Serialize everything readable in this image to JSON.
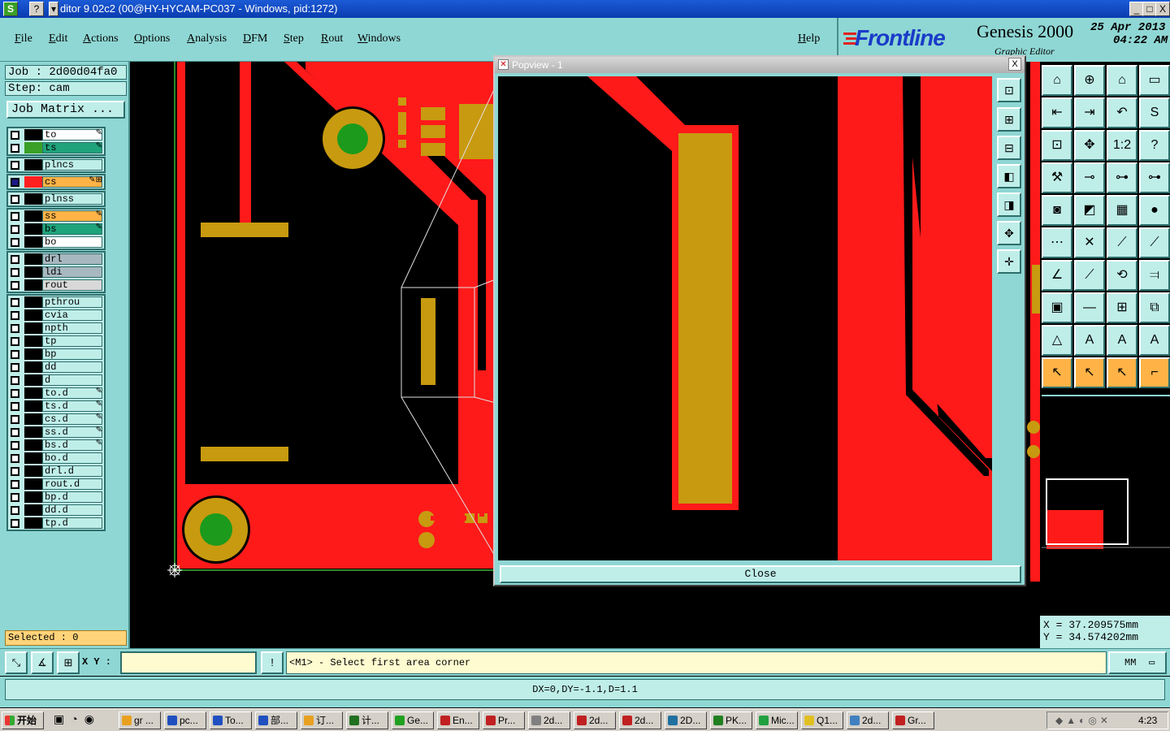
{
  "window": {
    "title": "ditor 9.02c2 (00@HY-HYCAM-PC037 - Windows, pid:1272)",
    "app_icon": "S",
    "help_icon": "?",
    "sys_buttons": [
      "_",
      "□",
      "X"
    ]
  },
  "menu": {
    "items": [
      "File",
      "Edit",
      "Actions",
      "Options",
      "Analysis",
      "DFM",
      "Step",
      "Rout",
      "Windows"
    ],
    "help": "Help"
  },
  "brand": {
    "logo": "Frontline",
    "product": "Genesis 2000",
    "subtitle": "Graphic Editor",
    "date": "25 Apr 2013",
    "time": "04:22 AM"
  },
  "job": {
    "job_label": "Job : 2d00d04fa0",
    "step_label": "Step: cam",
    "matrix_button": "Job Matrix ..."
  },
  "layers": {
    "group1": [
      {
        "name": "to",
        "color": "#ffffff",
        "swatch": "#000000",
        "mark": "✎"
      },
      {
        "name": "ts",
        "color": "#1fa37a",
        "swatch": "#3aa028",
        "mark": "✎"
      }
    ],
    "group2": [
      {
        "name": "plncs",
        "color": "#bfeee9",
        "swatch": "#000000",
        "mark": ""
      }
    ],
    "group3": [
      {
        "name": "cs",
        "color": "#ffb347",
        "swatch": "#ff2020",
        "mark": "✎⊞",
        "active": true
      }
    ],
    "group4": [
      {
        "name": "plnss",
        "color": "#bfeee9",
        "swatch": "#000000",
        "mark": ""
      }
    ],
    "group5": [
      {
        "name": "ss",
        "color": "#ffb347",
        "swatch": "#000000",
        "mark": "✎"
      },
      {
        "name": "bs",
        "color": "#1fa37a",
        "swatch": "#000000",
        "mark": "✎"
      },
      {
        "name": "bo",
        "color": "#ffffff",
        "swatch": "#000000",
        "mark": ""
      }
    ],
    "group6": [
      {
        "name": "drl",
        "color": "#a8b8c0",
        "swatch": "#000000",
        "mark": ""
      },
      {
        "name": "ldi",
        "color": "#a8b8c0",
        "swatch": "#000000",
        "mark": ""
      },
      {
        "name": "rout",
        "color": "#d8d8d8",
        "swatch": "#000000",
        "mark": ""
      }
    ],
    "group7": [
      {
        "name": "pthrou",
        "color": "#bfeee9",
        "swatch": "#000000",
        "mark": ""
      },
      {
        "name": "cvia",
        "color": "#bfeee9",
        "swatch": "#000000",
        "mark": ""
      },
      {
        "name": "npth",
        "color": "#bfeee9",
        "swatch": "#000000",
        "mark": ""
      },
      {
        "name": "tp",
        "color": "#bfeee9",
        "swatch": "#000000",
        "mark": ""
      },
      {
        "name": "bp",
        "color": "#bfeee9",
        "swatch": "#000000",
        "mark": ""
      },
      {
        "name": "dd",
        "color": "#bfeee9",
        "swatch": "#000000",
        "mark": ""
      },
      {
        "name": "d",
        "color": "#bfeee9",
        "swatch": "#000000",
        "mark": ""
      },
      {
        "name": "to.d",
        "color": "#bfeee9",
        "swatch": "#000000",
        "mark": "✎"
      },
      {
        "name": "ts.d",
        "color": "#bfeee9",
        "swatch": "#000000",
        "mark": "✎"
      },
      {
        "name": "cs.d",
        "color": "#bfeee9",
        "swatch": "#000000",
        "mark": "✎"
      },
      {
        "name": "ss.d",
        "color": "#bfeee9",
        "swatch": "#000000",
        "mark": "✎"
      },
      {
        "name": "bs.d",
        "color": "#bfeee9",
        "swatch": "#000000",
        "mark": "✎"
      },
      {
        "name": "bo.d",
        "color": "#bfeee9",
        "swatch": "#000000",
        "mark": ""
      },
      {
        "name": "drl.d",
        "color": "#bfeee9",
        "swatch": "#000000",
        "mark": ""
      },
      {
        "name": "rout.d",
        "color": "#bfeee9",
        "swatch": "#000000",
        "mark": ""
      },
      {
        "name": "bp.d",
        "color": "#bfeee9",
        "swatch": "#000000",
        "mark": ""
      },
      {
        "name": "dd.d",
        "color": "#bfeee9",
        "swatch": "#000000",
        "mark": ""
      },
      {
        "name": "tp.d",
        "color": "#bfeee9",
        "swatch": "#000000",
        "mark": ""
      }
    ]
  },
  "selected": "Selected : 0",
  "popview": {
    "title": "Popview - 1",
    "close_label": "Close",
    "close_x": "X"
  },
  "toolbar_icons": [
    "zoom-home",
    "zoom-in",
    "zoom-out",
    "layer-home",
    "window",
    "pan-left",
    "pan-right",
    "undo-view",
    "redo",
    "snap-s",
    "fit",
    "center",
    "scale-1-2",
    "help-query",
    "measure",
    "probe",
    "select-net",
    "select-layer"
  ],
  "coords": {
    "x": "X = 37.209575mm",
    "y": "Y = 34.574202mm"
  },
  "command": {
    "xy_label": "X Y :",
    "xy_value": "",
    "prompt": "<M1> - Select first area corner",
    "units": "MM",
    "exclaim": "!"
  },
  "status": "DX=0,DY=-1.1,D=1.1",
  "taskbar": {
    "start": "开始",
    "tasks": [
      "gr ...",
      "pc...",
      "To...",
      "部...",
      "订...",
      "计...",
      "Ge...",
      "En...",
      "Pr...",
      "2d...",
      "2d...",
      "2d...",
      "2D...",
      "PK...",
      "Mic...",
      "Q1...",
      "2d...",
      "Gr..."
    ],
    "clock": "4:23"
  },
  "colors": {
    "copper": "#ff1a1a",
    "pad": "#c89a10",
    "via": "#1c9a1c",
    "panel": "#8fd7d4",
    "panel_light": "#bfeee9"
  }
}
